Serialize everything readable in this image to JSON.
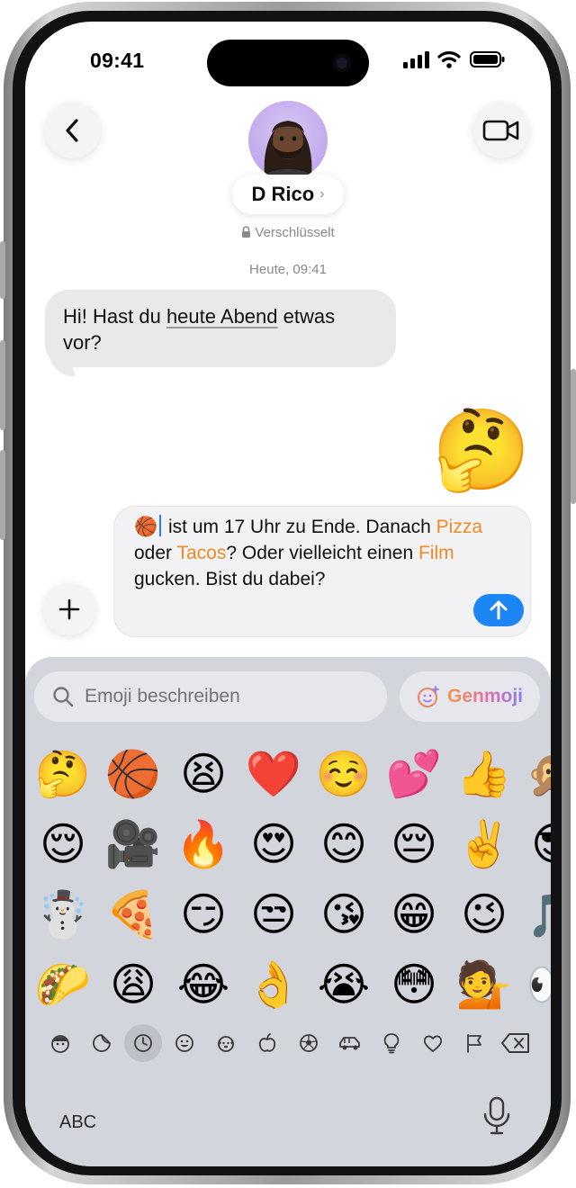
{
  "status_bar": {
    "time": "09:41"
  },
  "header": {
    "contact_name": "D Rico",
    "encryption_label": "Verschlüsselt"
  },
  "thread": {
    "timestamp": "Heute, 09:41",
    "incoming": {
      "before": "Hi! Hast du ",
      "underlined": "heute Abend",
      "after": " etwas vor?"
    },
    "sent_emoji": "🤔"
  },
  "composer": {
    "lead_emoji": "🏀",
    "t1": " ist um 17 Uhr zu Ende. Danach ",
    "k1": "Pizza",
    "t2": " oder ",
    "k2": "Tacos",
    "t3": "? Oder vielleicht einen ",
    "k3": "Film",
    "t4": " gucken. Bist du dabei?"
  },
  "keyboard": {
    "search_placeholder": "Emoji beschreiben",
    "genmoji_label": "Genmoji",
    "abc_label": "ABC",
    "emoji_rows": [
      [
        "🤔",
        "🏀",
        "😫",
        "❤️",
        "☺️",
        "💕",
        "👍",
        "🙊"
      ],
      [
        "😌",
        "🎥",
        "🔥",
        "😍",
        "😊",
        "😔",
        "✌️",
        "😎"
      ],
      [
        "☃️",
        "🍕",
        "😏",
        "😒",
        "😘",
        "😁",
        "😉",
        "🎵"
      ],
      [
        "🌮",
        "😩",
        "😂",
        "👌",
        "😭",
        "😳",
        "💁",
        "👀"
      ]
    ],
    "categories": [
      "memoji-icon",
      "sticker-icon",
      "recent-icon",
      "smileys-icon",
      "animals-icon",
      "food-icon",
      "activity-icon",
      "travel-icon",
      "objects-icon",
      "symbols-icon",
      "flags-icon"
    ]
  },
  "colors": {
    "accent": "#1d86f5",
    "keyword": "#f08a24"
  }
}
